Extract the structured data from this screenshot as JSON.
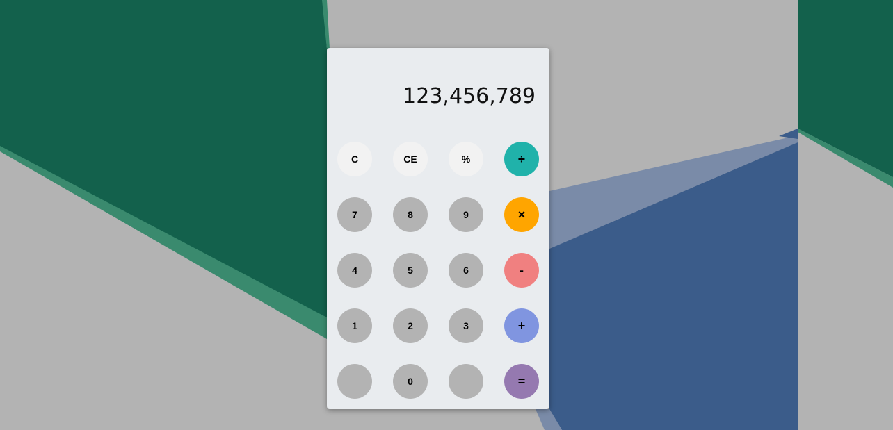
{
  "display": {
    "value": "123,456,789"
  },
  "keys": {
    "clear": "C",
    "clear_entry": "CE",
    "percent": "%",
    "divide": "÷",
    "seven": "7",
    "eight": "8",
    "nine": "9",
    "multiply": "×",
    "four": "4",
    "five": "5",
    "six": "6",
    "subtract": "-",
    "one": "1",
    "two": "2",
    "three": "3",
    "add": "+",
    "blank_left": "",
    "zero": "0",
    "blank_right": "",
    "equals": "="
  },
  "colors": {
    "background": "#b3b3b3",
    "panel": "#e9ecef",
    "function_key": "#f2f2f2",
    "number_key": "#b3b3b3",
    "divide_key": "#20b2aa",
    "multiply_key": "#ffa500",
    "subtract_key": "#f08080",
    "add_key": "#8095e0",
    "equals_key": "#9579b0",
    "green_shape": "#13614c",
    "blue_shape": "#3b5c8a"
  }
}
